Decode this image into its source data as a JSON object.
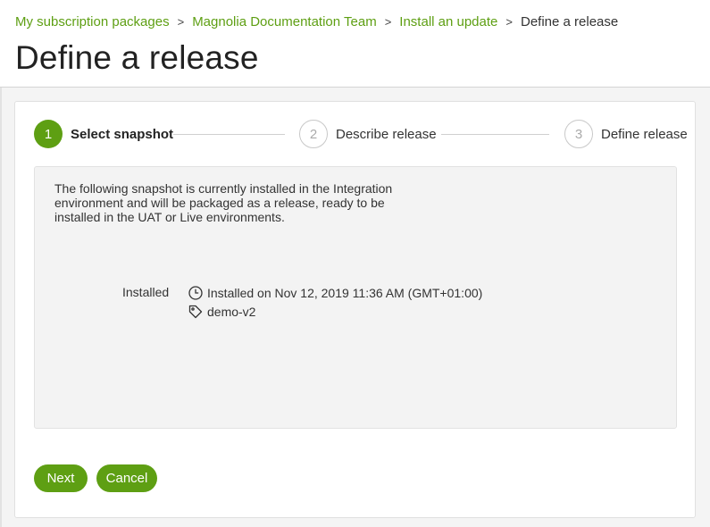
{
  "breadcrumb": {
    "items": [
      "My subscription packages",
      "Magnolia Documentation Team",
      "Install an update"
    ],
    "current": "Define a release",
    "separator": ">"
  },
  "page_title": "Define a release",
  "steps": [
    {
      "number": "1",
      "label": "Select snapshot",
      "state": "active"
    },
    {
      "number": "2",
      "label": "Describe release",
      "state": "inactive"
    },
    {
      "number": "3",
      "label": "Define release",
      "state": "inactive"
    }
  ],
  "panel": {
    "description": "The following snapshot is currently installed in the Integration environment and will be packaged as a release, ready to be installed in the UAT or Live environments.",
    "label": "Installed",
    "installed_on": "Installed on Nov 12, 2019 11:36 AM (GMT+01:00)",
    "tag": "demo-v2",
    "icons": {
      "time": "clock-icon",
      "tag": "tag-icon"
    }
  },
  "buttons": {
    "next": "Next",
    "cancel": "Cancel"
  },
  "colors": {
    "accent": "#5e9f13",
    "panel_bg": "#f3f3f3",
    "page_bg": "#f4f4f4"
  }
}
